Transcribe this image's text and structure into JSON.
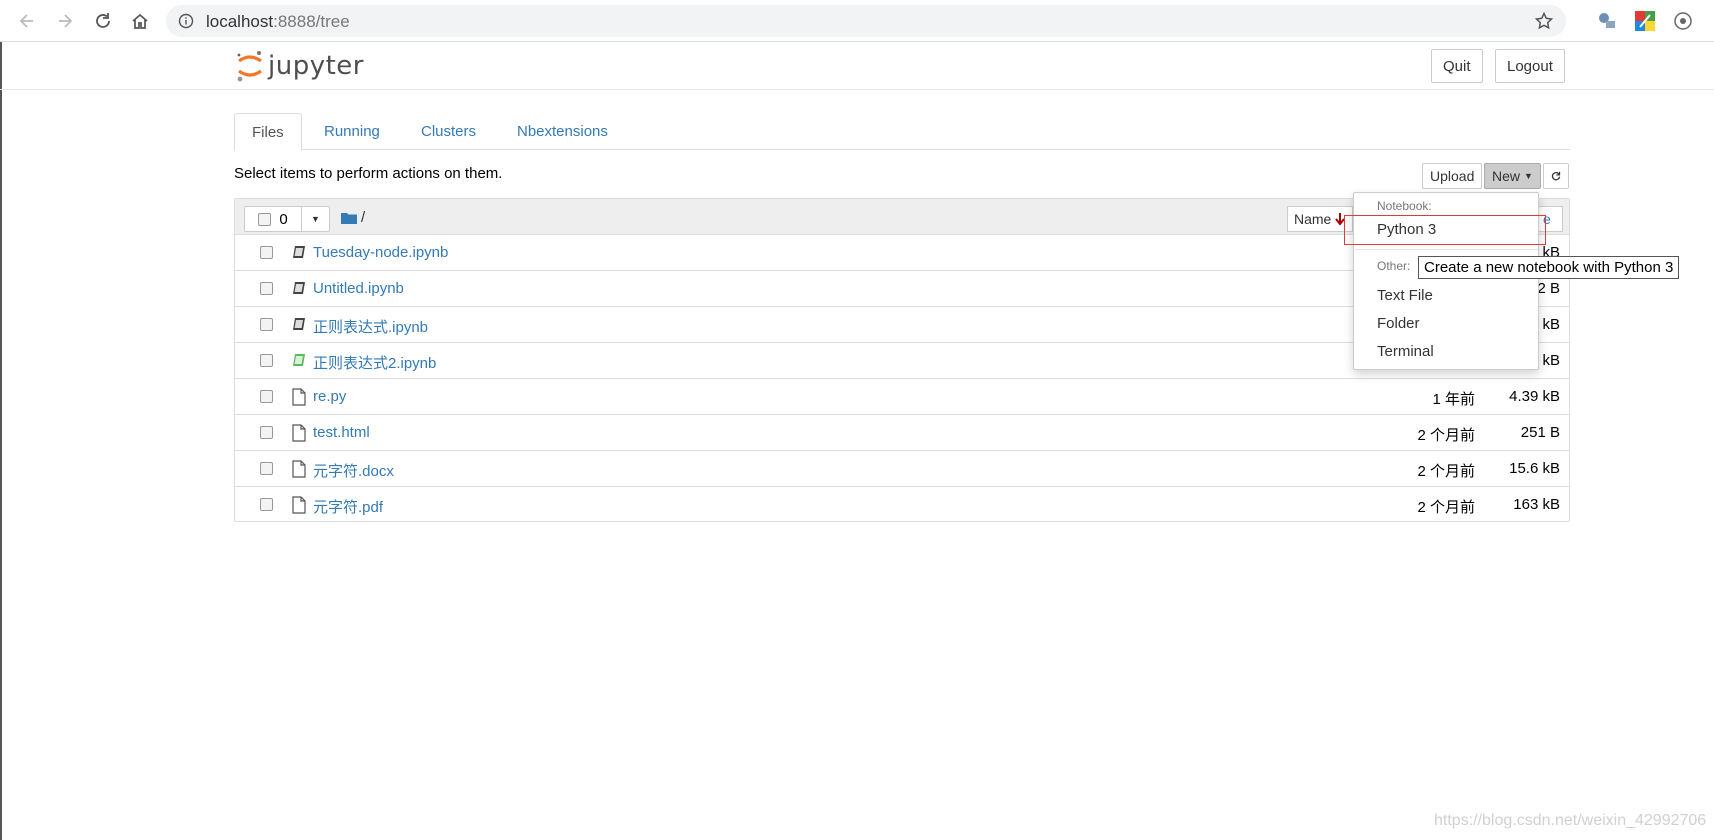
{
  "browser": {
    "url_host": "localhost",
    "url_rest": ":8888/tree"
  },
  "header": {
    "logo_text": "jupyter",
    "quit_label": "Quit",
    "logout_label": "Logout"
  },
  "tabs": [
    {
      "label": "Files",
      "active": true
    },
    {
      "label": "Running",
      "active": false
    },
    {
      "label": "Clusters",
      "active": false
    },
    {
      "label": "Nbextensions",
      "active": false
    }
  ],
  "toolbar": {
    "hint": "Select items to perform actions on them.",
    "upload_label": "Upload",
    "new_label": "New",
    "selected_count": "0",
    "breadcrumb": "/",
    "sort_label": "Name",
    "size_header_partial": "e"
  },
  "files": [
    {
      "name": "Tuesday-node.ipynb",
      "type": "notebook",
      "date": "",
      "size": "kB"
    },
    {
      "name": "Untitled.ipynb",
      "type": "notebook",
      "date": "",
      "size": "2 B"
    },
    {
      "name": "正则表达式.ipynb",
      "type": "notebook",
      "date": "",
      "size": "kB"
    },
    {
      "name": "正则表达式2.ipynb",
      "type": "notebook-running",
      "date": "",
      "size": "kB"
    },
    {
      "name": "re.py",
      "type": "file",
      "date": "1 年前",
      "size": "4.39 kB"
    },
    {
      "name": "test.html",
      "type": "file",
      "date": "2 个月前",
      "size": "251 B"
    },
    {
      "name": "元字符.docx",
      "type": "file",
      "date": "2 个月前",
      "size": "15.6 kB"
    },
    {
      "name": "元字符.pdf",
      "type": "file",
      "date": "2 个月前",
      "size": "163 kB"
    }
  ],
  "new_menu": {
    "notebook_header": "Notebook:",
    "python3": "Python 3",
    "other_header": "Other:",
    "text_file": "Text File",
    "folder": "Folder",
    "terminal": "Terminal",
    "tooltip": "Create a new notebook with Python 3"
  },
  "watermark": "https://blog.csdn.net/weixin_42992706",
  "colors": {
    "link": "#337ab7",
    "highlight": "#e0393e",
    "running_notebook": "#5cb85c",
    "jupyter_orange": "#f37726"
  }
}
